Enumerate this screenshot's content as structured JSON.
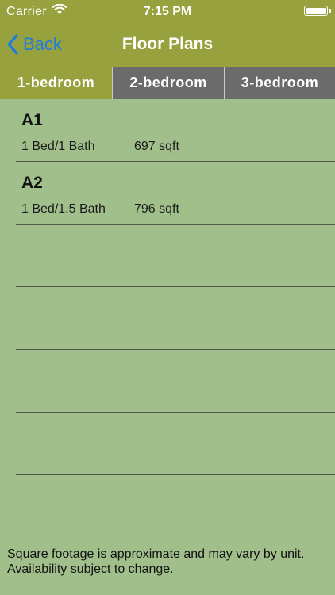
{
  "status_bar": {
    "carrier": "Carrier",
    "time": "7:15 PM",
    "wifi_icon": "wifi-icon",
    "battery_icon": "battery-icon"
  },
  "nav": {
    "back_label": "Back",
    "back_icon": "chevron-left-icon",
    "title": "Floor Plans"
  },
  "tabs": [
    {
      "label": "1-bedroom",
      "selected": true
    },
    {
      "label": "2-bedroom",
      "selected": false
    },
    {
      "label": "3-bedroom",
      "selected": false
    }
  ],
  "floor_plans": [
    {
      "name": "A1",
      "beds_baths": "1 Bed/1 Bath",
      "sqft": "697 sqft"
    },
    {
      "name": "A2",
      "beds_baths": "1 Bed/1.5 Bath",
      "sqft": "796 sqft"
    }
  ],
  "disclaimer": {
    "line1": "Square footage is approximate and may vary by unit.",
    "line2": "Availability subject to change."
  },
  "colors": {
    "header_bg": "#97a23e",
    "content_bg": "#a0bf8a",
    "tab_selected_bg": "#97a23e",
    "tab_unselected_bg": "#6b6b6b",
    "back_link": "#1d7ce0",
    "separator": "#4f5a48"
  }
}
